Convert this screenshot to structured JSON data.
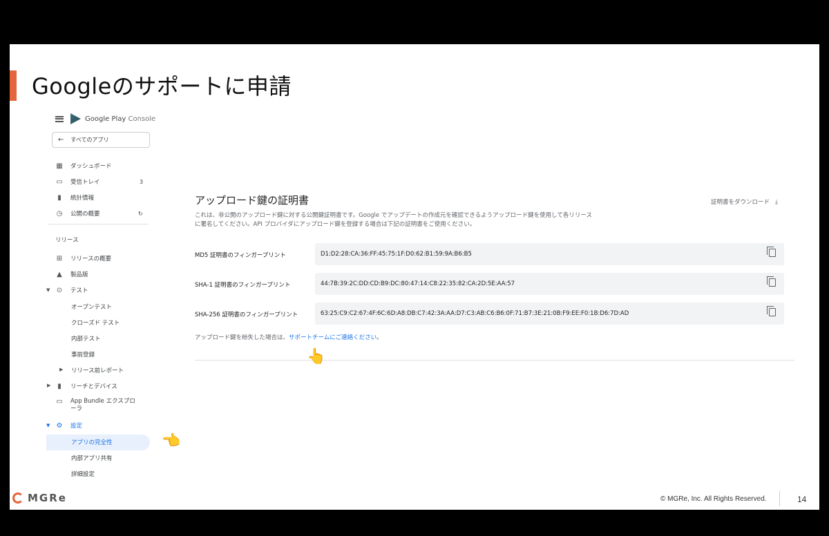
{
  "slide": {
    "title": "Googleのサポートに申請",
    "footer": {
      "logo_text": "MGRe",
      "copyright": "© MGRe, Inc. All Rights Reserved.",
      "page_number": "14"
    }
  },
  "sidebar": {
    "brand": {
      "name": "Google Play",
      "suffix": "Console"
    },
    "all_apps": "すべてのアプリ",
    "items": [
      {
        "label": "ダッシュボード",
        "icon": "dashboard-icon"
      },
      {
        "label": "受信トレイ",
        "icon": "inbox-icon",
        "badge": "3"
      },
      {
        "label": "統計情報",
        "icon": "bar-chart-icon"
      },
      {
        "label": "公開の概要",
        "icon": "publishing-icon"
      }
    ],
    "release_section": "リリース",
    "release_items": [
      {
        "label": "リリースの概要",
        "icon": "release-overview-icon"
      },
      {
        "label": "製品版",
        "icon": "production-icon"
      },
      {
        "label": "テスト",
        "icon": "testing-icon"
      }
    ],
    "test_sub": [
      "オープンテスト",
      "クローズド テスト",
      "内部テスト",
      "事前登録"
    ],
    "prelaunch": "リリース前レポート",
    "reach": "リーチとデバイス",
    "bundle_explorer": "App Bundle エクスプローラ",
    "settings": "設定",
    "settings_sub": [
      "アプリの完全性",
      "内部アプリ共有",
      "詳細設定"
    ]
  },
  "main": {
    "title": "アップロード鍵の証明書",
    "download": "証明書をダウンロード",
    "description": "これは、非公開のアップロード鍵に対する公開鍵証明書です。Google でアップデートの作成元を確認できるようアップロード鍵を使用して各リリースに署名してください。API プロバイダにアップロード鍵を登録する場合は下記の証明書をご使用ください。",
    "fingerprints": [
      {
        "label": "MD5 証明書のフィンガープリント",
        "value": "D1:D2:28:CA:36:FF:45:75:1F:D0:62:B1:59:9A:B6:B5"
      },
      {
        "label": "SHA-1 証明書のフィンガープリント",
        "value": "44:7B:39:2C:DD:CD:B9:DC:80:47:14:C8:22:35:82:CA:2D:5E:AA:57"
      },
      {
        "label": "SHA-256 証明書のフィンガープリント",
        "value": "63:25:C9:C2:67:4F:6C:6D:A8:DB:C7:42:3A:AA:D7:C3:AB:C6:B6:0F:71:B7:3E:21:0B:F9:EE:F0:1B:D6:7D:AD"
      }
    ],
    "lost_prefix": "アップロード鍵を紛失した場合は、",
    "lost_link": "サポートチームにご連絡ください",
    "lost_suffix": "。"
  },
  "colors": {
    "accent": "#e4643c",
    "link": "#1a73e8",
    "active_bg": "#e8f0fe"
  }
}
